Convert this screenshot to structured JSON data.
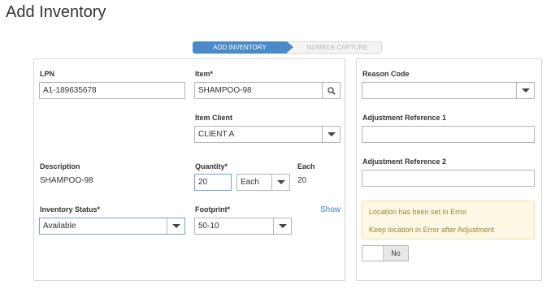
{
  "page": {
    "title": "Add Inventory"
  },
  "steps": [
    {
      "label": "ADD INVENTORY",
      "active": true
    },
    {
      "label": "NUMBER CAPTURE",
      "active": false
    }
  ],
  "left": {
    "lpn": {
      "label": "LPN",
      "value": "A1-189635678"
    },
    "item": {
      "label": "Item*",
      "value": "SHAMPOO-98",
      "icon": "search-icon"
    },
    "item_client": {
      "label": "Item Client",
      "value": "CLIENT A"
    },
    "description": {
      "label": "Description",
      "value": "SHAMPOO-98"
    },
    "quantity": {
      "label": "Quantity*",
      "value": "20",
      "uom": "Each"
    },
    "each": {
      "label": "Each",
      "value": "20"
    },
    "inventory_status": {
      "label": "Inventory Status*",
      "value": "Available"
    },
    "footprint": {
      "label": "Footprint*",
      "value": "50-10",
      "link": "Show"
    }
  },
  "right": {
    "reason_code": {
      "label": "Reason Code",
      "value": ""
    },
    "adj_ref_1": {
      "label": "Adjustment Reference 1",
      "value": ""
    },
    "adj_ref_2": {
      "label": "Adjustment Reference 2",
      "value": ""
    },
    "alert": {
      "line1": "Location has been set in Error",
      "line2": "Keep location in Error after Adjustment"
    },
    "toggle": {
      "state": "No"
    }
  },
  "colors": {
    "accent": "#4a8ac9",
    "alert_bg": "#fcf8e3",
    "alert_text": "#a0813e",
    "link": "#3a7dbf"
  }
}
